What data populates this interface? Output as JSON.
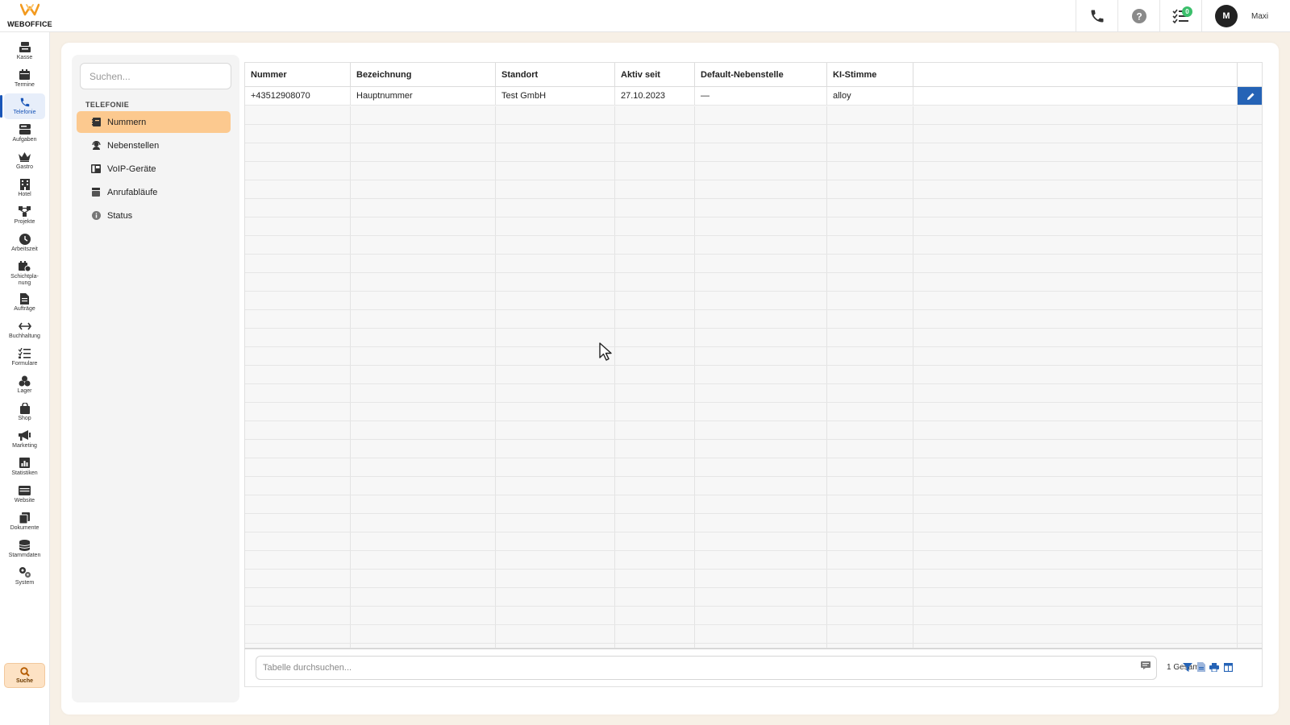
{
  "brand": {
    "name": "WEBOFFICE",
    "accent": "#f29a1f"
  },
  "topbar": {
    "badge_count": "0",
    "user_initial": "M",
    "user_name": "Maxi"
  },
  "nav": {
    "items": [
      {
        "label": "Kasse",
        "icon": "cash-register-icon"
      },
      {
        "label": "Termine",
        "icon": "calendar-icon"
      },
      {
        "label": "Telefonie",
        "icon": "phone-icon",
        "active": true
      },
      {
        "label": "Aufgaben",
        "icon": "tasks-icon"
      },
      {
        "label": "Gastro",
        "icon": "crown-icon"
      },
      {
        "label": "Hotel",
        "icon": "building-icon"
      },
      {
        "label": "Projekte",
        "icon": "project-icon"
      },
      {
        "label": "Arbeitszeit",
        "icon": "clock-icon"
      },
      {
        "label": "Schichtpla-",
        "label2": "nung",
        "icon": "shift-icon"
      },
      {
        "label": "Aufträge",
        "icon": "document-icon"
      },
      {
        "label": "Buchhaltung",
        "icon": "arrows-icon"
      },
      {
        "label": "Formulare",
        "icon": "form-list-icon"
      },
      {
        "label": "Lager",
        "icon": "boxes-icon"
      },
      {
        "label": "Shop",
        "icon": "bag-icon"
      },
      {
        "label": "Marketing",
        "icon": "megaphone-icon"
      },
      {
        "label": "Statistiken",
        "icon": "chart-icon"
      },
      {
        "label": "Website",
        "icon": "browser-icon"
      },
      {
        "label": "Dokumente",
        "icon": "files-icon"
      },
      {
        "label": "Stammdaten",
        "icon": "database-icon"
      },
      {
        "label": "System",
        "icon": "gears-icon"
      }
    ],
    "search_label": "Suche"
  },
  "subnav": {
    "search_placeholder": "Suchen...",
    "section": "TELEFONIE",
    "items": [
      {
        "label": "Nummern",
        "icon": "phonebook-icon",
        "active": true
      },
      {
        "label": "Nebenstellen",
        "icon": "headset-icon"
      },
      {
        "label": "VoIP-Geräte",
        "icon": "voip-phone-icon"
      },
      {
        "label": "Anrufabläufe",
        "icon": "flow-icon"
      },
      {
        "label": "Status",
        "icon": "info-icon"
      }
    ]
  },
  "table": {
    "columns": [
      "Nummer",
      "Bezeichnung",
      "Standort",
      "Aktiv seit",
      "Default-Nebenstelle",
      "KI-Stimme"
    ],
    "rows": [
      [
        "+43512908070",
        "Hauptnummer",
        "Test GmbH",
        "27.10.2023",
        "—",
        "alloy"
      ]
    ]
  },
  "footer": {
    "search_placeholder": "Tabelle durchsuchen...",
    "total": "1 Gesamt"
  },
  "colors": {
    "active_subitem": "#fcc98f",
    "edit_button": "#2563b6",
    "active_nav": "#1a56b8"
  }
}
